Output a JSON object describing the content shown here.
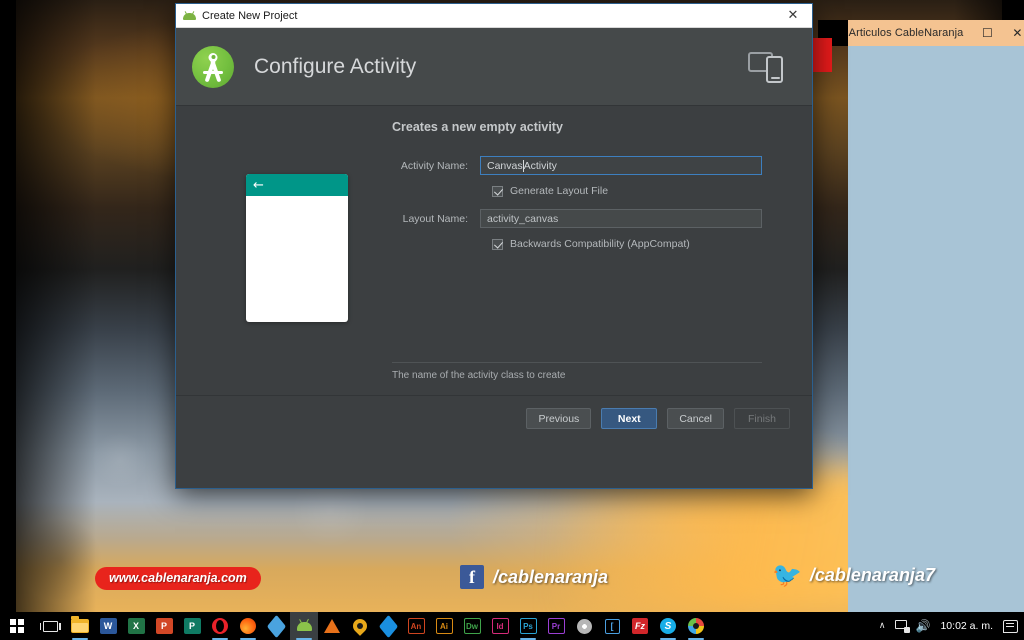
{
  "desktop": {
    "wallpaper_name": "autumn-road-wallpaper",
    "background_window": {
      "title": "Articulos CableNaranja",
      "maximize_label": "☐",
      "close_label": "✕"
    }
  },
  "dialog": {
    "titlebar": {
      "title": "Create New Project",
      "icon": "android-icon",
      "close_label": "✕"
    },
    "header": {
      "title": "Configure Activity",
      "logo": "android-studio-logo",
      "device_icon": "tablet-and-phone-icon"
    },
    "preview": {
      "back_arrow": "←",
      "appbar_color": "#009688"
    },
    "form": {
      "heading": "Creates a new empty activity",
      "activity_name_label": "Activity Name:",
      "activity_name_value_before_caret": "Canvas",
      "activity_name_value_after_caret": "Activity",
      "generate_layout_label": "Generate Layout File",
      "generate_layout_checked": true,
      "layout_name_label": "Layout Name:",
      "layout_name_value": "activity_canvas",
      "backwards_compat_label": "Backwards Compatibility (AppCompat)",
      "backwards_compat_checked": true
    },
    "hint": "The name of the activity class to create",
    "buttons": {
      "previous": "Previous",
      "next": "Next",
      "cancel": "Cancel",
      "finish": "Finish"
    },
    "accent_color": "#365880"
  },
  "watermarks": {
    "website": "www.cablenaranja.com",
    "facebook_handle": "/cablenaranja",
    "twitter_handle": "/cablenaranja7",
    "facebook_icon": "facebook-icon",
    "twitter_icon": "twitter-bird-icon",
    "website_badge_color": "#e8241c"
  },
  "taskbar": {
    "start_label": "start-button",
    "task_view_label": "task-view-button",
    "items": [
      {
        "name": "file-explorer-icon",
        "kind": "folder",
        "label": "",
        "color": "#f0b429",
        "active": false,
        "underline": true
      },
      {
        "name": "word-icon",
        "kind": "badge",
        "label": "W",
        "color": "#2b579a",
        "active": false,
        "underline": false
      },
      {
        "name": "excel-icon",
        "kind": "badge",
        "label": "X",
        "color": "#217346",
        "active": false,
        "underline": false
      },
      {
        "name": "powerpoint-icon",
        "kind": "badge",
        "label": "P",
        "color": "#d24726",
        "active": false,
        "underline": false
      },
      {
        "name": "publisher-icon",
        "kind": "badge",
        "label": "P",
        "color": "#0f7a63",
        "active": false,
        "underline": false
      },
      {
        "name": "opera-icon",
        "kind": "opera",
        "label": "",
        "color": "#e8222a",
        "active": false,
        "underline": true
      },
      {
        "name": "firefox-icon",
        "kind": "firefox",
        "label": "",
        "color": "#ff6611",
        "active": false,
        "underline": true
      },
      {
        "name": "cube-app-icon",
        "kind": "cube",
        "label": "",
        "color": "#4aa3df",
        "active": false,
        "underline": false
      },
      {
        "name": "android-studio-icon",
        "kind": "android",
        "label": "",
        "color": "#8bc34a",
        "active": true,
        "underline": true
      },
      {
        "name": "vlc-icon",
        "kind": "vlc",
        "label": "",
        "color": "#e8711a",
        "active": false,
        "underline": false
      },
      {
        "name": "utorrent-icon",
        "kind": "drop",
        "label": "",
        "color": "#e8a81a",
        "active": false,
        "underline": false
      },
      {
        "name": "dropbox-icon",
        "kind": "cube",
        "label": "",
        "color": "#1a8fe0",
        "active": false,
        "underline": false
      },
      {
        "name": "adobe-animate-icon",
        "kind": "adobe",
        "label": "An",
        "color": "#cf4520",
        "active": false,
        "underline": false
      },
      {
        "name": "adobe-illustrator-icon",
        "kind": "adobe",
        "label": "Ai",
        "color": "#d88a14",
        "active": false,
        "underline": false
      },
      {
        "name": "adobe-dreamweaver-icon",
        "kind": "adobe",
        "label": "Dw",
        "color": "#3fa34a",
        "active": false,
        "underline": false
      },
      {
        "name": "adobe-indesign-icon",
        "kind": "adobe",
        "label": "Id",
        "color": "#d62b7a",
        "active": false,
        "underline": false
      },
      {
        "name": "adobe-photoshop-icon",
        "kind": "adobe",
        "label": "Ps",
        "color": "#2aa3d4",
        "active": false,
        "underline": true
      },
      {
        "name": "adobe-premiere-icon",
        "kind": "adobe",
        "label": "Pr",
        "color": "#9b3fd4",
        "active": false,
        "underline": false
      },
      {
        "name": "chrome-gray-icon",
        "kind": "chrome",
        "label": "",
        "color": "#b6b6b6",
        "active": false,
        "underline": false
      },
      {
        "name": "notepad-app-icon",
        "kind": "sq",
        "label": "[",
        "color": "#4a9fe0",
        "active": false,
        "underline": false
      },
      {
        "name": "filezilla-icon",
        "kind": "fz",
        "label": "Fz",
        "color": "#d1262a",
        "active": false,
        "underline": false
      },
      {
        "name": "skype-icon",
        "kind": "skype",
        "label": "S",
        "color": "#18aee8",
        "active": false,
        "underline": true
      },
      {
        "name": "paint-icon",
        "kind": "paint",
        "label": "",
        "color": "#e84a3f",
        "active": false,
        "underline": true
      }
    ],
    "tray": {
      "chevron": "∧",
      "network_icon": "network-icon",
      "volume_icon": "🔊",
      "clock": "10:02 a. m.",
      "notifications_icon": "notifications-icon"
    }
  }
}
